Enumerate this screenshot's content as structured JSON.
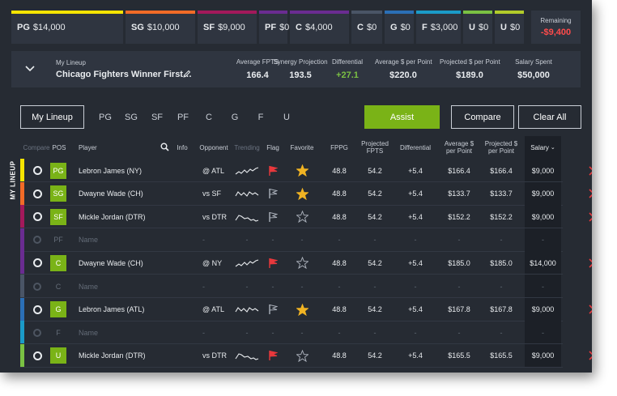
{
  "salary_slots": [
    {
      "pos": "PG",
      "amount": "$14,000",
      "color": "#f5e400",
      "width": 138
    },
    {
      "pos": "SG",
      "amount": "$10,000",
      "color": "#f26b27",
      "width": 86
    },
    {
      "pos": "SF",
      "amount": "$9,000",
      "color": "#a3195b",
      "width": 73
    },
    {
      "pos": "PF",
      "amount": "$0",
      "color": "#6a2c91",
      "width": 35
    },
    {
      "pos": "C",
      "amount": "$4,000",
      "color": "#6a2c91",
      "width": 73
    },
    {
      "pos": "C",
      "amount": "$0",
      "color": "#4a5566",
      "width": 38
    },
    {
      "pos": "G",
      "amount": "$0",
      "color": "#2b6fb6",
      "width": 36
    },
    {
      "pos": "F",
      "amount": "$3,000",
      "color": "#1b9bc8",
      "width": 55
    },
    {
      "pos": "U",
      "amount": "$0",
      "color": "#7ac143",
      "width": 36
    },
    {
      "pos": "U",
      "amount": "$0",
      "color": "#b2cc2a",
      "width": 36
    }
  ],
  "remaining": {
    "label": "Remaining",
    "value": "-$9,400"
  },
  "lineup": {
    "sub_label": "My Lineup",
    "name": "Chicago Fighters Winner First…",
    "stats": [
      {
        "label": "Average FPTS",
        "value": "166.4",
        "green": false
      },
      {
        "label": "Synergy Projection",
        "value": "193.5",
        "green": false
      },
      {
        "label": "Differential",
        "value": "+27.1",
        "green": true
      },
      {
        "label": "Average $ per Point",
        "value": "$220.0",
        "green": false
      },
      {
        "label": "Projected $ per Point",
        "value": "$189.0",
        "green": false
      },
      {
        "label": "Salary Spent",
        "value": "$50,000",
        "green": false
      }
    ]
  },
  "tabs": {
    "main": "My Lineup",
    "positions": [
      "PG",
      "SG",
      "SF",
      "PF",
      "C",
      "G",
      "F",
      "U"
    ]
  },
  "buttons": {
    "assist": "Assist",
    "compare": "Compare",
    "clear_all": "Clear All"
  },
  "side_label": "MY LINEUP",
  "columns": {
    "compare": "Compare",
    "pos": "POS",
    "player": "Player",
    "info": "Info",
    "opponent": "Opponent",
    "trending": "Trending",
    "flag": "Flag",
    "favorite": "Favorite",
    "fppg": "FPPG",
    "projected_fpts": "Projected FPTS",
    "differential": "Differential",
    "avg_per_point": "Average $ per Point",
    "proj_per_point": "Projected $ per Point",
    "salary": "Salary"
  },
  "colors": {
    "accent": "#7ab317",
    "remaining": "#ff4b4b",
    "delete": "#e8383c",
    "flag_on": "#e8383c",
    "star": "#f0b323"
  },
  "rows": [
    {
      "pos": "PG",
      "filled": true,
      "stripe": "#f5e400",
      "player": "Lebron James (NY)",
      "opponent": "@ ATL",
      "flag": true,
      "favorite": true,
      "fppg": "48.8",
      "proj": "54.2",
      "diff": "+5.4",
      "avg": "$166.4",
      "projpp": "$166.4",
      "salary": "$9,000"
    },
    {
      "pos": "SG",
      "filled": true,
      "stripe": "#f26b27",
      "player": "Dwayne Wade (CH)",
      "opponent": "vs SF",
      "flag": false,
      "favorite": true,
      "fppg": "48.8",
      "proj": "54.2",
      "diff": "+5.4",
      "avg": "$133.7",
      "projpp": "$133.7",
      "salary": "$9,000"
    },
    {
      "pos": "SF",
      "filled": true,
      "stripe": "#a3195b",
      "player": "Mickle Jordan (DTR)",
      "opponent": "vs DTR",
      "flag": false,
      "favorite": false,
      "fppg": "48.8",
      "proj": "54.2",
      "diff": "+5.4",
      "avg": "$152.2",
      "projpp": "$152.2",
      "salary": "$9,000"
    },
    {
      "pos": "PF",
      "filled": false,
      "stripe": "#6a2c91",
      "player": "Name",
      "opponent": "-",
      "fppg": "-",
      "proj": "-",
      "diff": "-",
      "avg": "-",
      "projpp": "-",
      "salary": "-",
      "trend": "-",
      "flag_t": "-",
      "fav_t": "-"
    },
    {
      "pos": "C",
      "filled": true,
      "stripe": "#6a2c91",
      "player": "Dwayne Wade (CH)",
      "opponent": "@ NY",
      "flag": true,
      "favorite": false,
      "fppg": "48.8",
      "proj": "54.2",
      "diff": "+5.4",
      "avg": "$185.0",
      "projpp": "$185.0",
      "salary": "$14,000"
    },
    {
      "pos": "C",
      "filled": false,
      "stripe": "#4a5566",
      "player": "Name",
      "opponent": "-",
      "fppg": "-",
      "proj": "-",
      "diff": "-",
      "avg": "-",
      "projpp": "-",
      "salary": "-",
      "trend": "-",
      "flag_t": "-",
      "fav_t": "-"
    },
    {
      "pos": "G",
      "filled": true,
      "stripe": "#2b6fb6",
      "player": "Lebron James (ATL)",
      "opponent": "@ ATL",
      "flag": false,
      "favorite": true,
      "fppg": "48.8",
      "proj": "54.2",
      "diff": "+5.4",
      "avg": "$167.8",
      "projpp": "$167.8",
      "salary": "$9,000"
    },
    {
      "pos": "F",
      "filled": false,
      "stripe": "#1b9bc8",
      "player": "Name",
      "opponent": "-",
      "fppg": "-",
      "proj": "-",
      "diff": "-",
      "avg": "-",
      "projpp": "-",
      "salary": "-",
      "trend": "-",
      "flag_t": "-",
      "fav_t": "-"
    },
    {
      "pos": "U",
      "filled": true,
      "stripe": "#7ac143",
      "player": "Mickle Jordan (DTR)",
      "opponent": "vs DTR",
      "flag": true,
      "favorite": false,
      "fppg": "48.8",
      "proj": "54.2",
      "diff": "+5.4",
      "avg": "$165.5",
      "projpp": "$165.5",
      "salary": "$9,000"
    }
  ]
}
